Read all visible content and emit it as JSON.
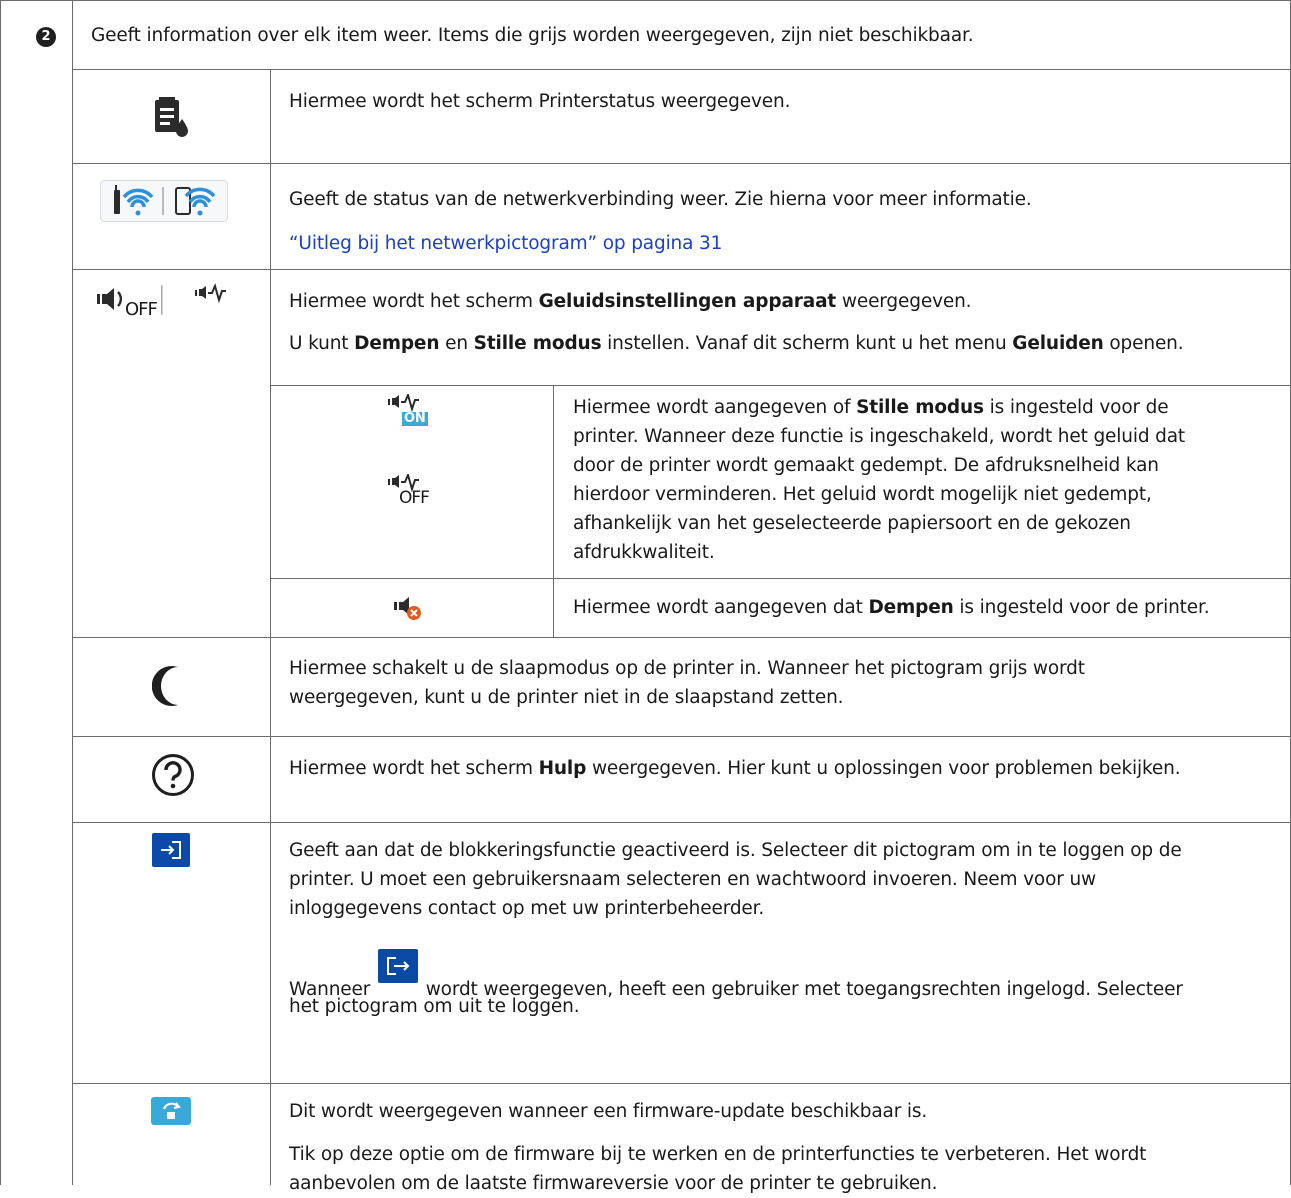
{
  "section_number": "2",
  "intro": "Geeft information over elk item weer. Items die grijs worden weergegeven, zijn niet beschikbaar.",
  "rows": {
    "printer_status": {
      "icon": "printer-status-icon",
      "text": "Hiermee wordt het scherm Printerstatus weergegeven."
    },
    "network": {
      "icon": "wifi-icon",
      "text": "Geeft de status van de netwerkverbinding weer. Zie hierna voor meer informatie.",
      "link": "“Uitleg bij het netwerkpictogram” op pagina 31"
    },
    "sound": {
      "icon": "speaker-icon",
      "off_label": "OFF",
      "line1_pre": "Hiermee wordt het scherm ",
      "line1_bold": "Geluidsinstellingen apparaat",
      "line1_post": " weergegeven.",
      "line2_a": "U kunt ",
      "line2_b": "Dempen",
      "line2_c": " en ",
      "line2_d": "Stille modus",
      "line2_e": " instellen. Vanaf dit scherm kunt u het menu ",
      "line2_f": "Geluiden",
      "line2_g": " openen.",
      "quiet": {
        "on_label": "ON",
        "off_label": "OFF",
        "l1_pre": "Hiermee wordt aangegeven of ",
        "l1_bold": "Stille modus",
        "l1_post": " is ingesteld voor de",
        "l2": "printer. Wanneer deze functie is ingeschakeld, wordt het geluid dat",
        "l3": "door de printer wordt gemaakt gedempt. De afdruksnelheid kan",
        "l4": "hierdoor verminderen. Het geluid wordt mogelijk niet gedempt,",
        "l5": "afhankelijk van het geselecteerde papiersoort en de gekozen",
        "l6": "afdrukkwaliteit."
      },
      "mute": {
        "pre": "Hiermee wordt aangegeven dat ",
        "bold": "Dempen",
        "post": " is ingesteld voor de printer."
      }
    },
    "sleep": {
      "icon": "moon-icon",
      "l1": "Hiermee schakelt u de slaapmodus op de printer in. Wanneer het pictogram grijs wordt",
      "l2": "weergegeven, kunt u de printer niet in de slaapstand zetten."
    },
    "help": {
      "icon": "help-icon",
      "pre": "Hiermee wordt het scherm ",
      "bold": "Hulp",
      "post": " weergegeven. Hier kunt u oplossingen voor problemen bekijken."
    },
    "login": {
      "icon": "login-icon",
      "l1": "Geeft aan dat de blokkeringsfunctie geactiveerd is. Selecteer dit pictogram om in te loggen op de",
      "l2": "printer. U moet een gebruikersnaam selecteren en wachtwoord invoeren. Neem voor uw",
      "l3": "inloggegevens contact op met uw printerbeheerder.",
      "l4_pre": "Wanneer",
      "l4_post": "wordt weergegeven, heeft een gebruiker met toegangsrechten ingelogd. Selecteer",
      "l5": "het pictogram om uit te loggen."
    },
    "firmware": {
      "icon": "firmware-update-icon",
      "l1": "Dit wordt weergegeven wanneer een firmware-update beschikbaar is.",
      "l2": "Tik op deze optie om de firmware bij te werken en de printerfuncties te verbeteren. Het wordt",
      "l3": "aanbevolen om de laatste firmwareversie voor de printer te gebruiken."
    }
  },
  "colors": {
    "rule": "#6b6b6b",
    "link": "#1a3fd1",
    "icon_blue": "#0a4aa6",
    "icon_light_blue": "#39a9d8",
    "mute_orange": "#e55a1c"
  }
}
